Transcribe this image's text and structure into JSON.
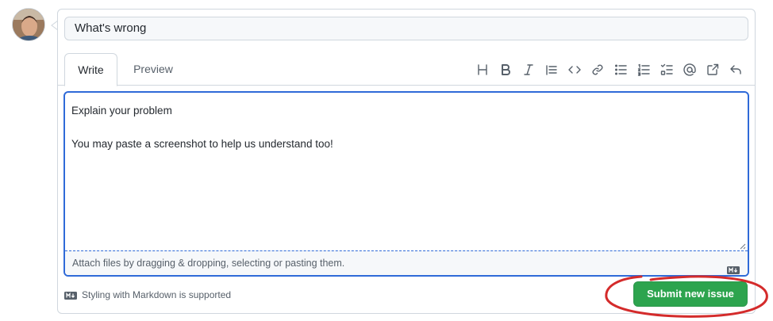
{
  "issue_form": {
    "title_value": "What's wrong",
    "tabs": [
      {
        "label": "Write",
        "active": true
      },
      {
        "label": "Preview",
        "active": false
      }
    ],
    "toolbar": [
      {
        "name": "heading-icon",
        "glyph": "H"
      },
      {
        "name": "bold-icon",
        "glyph": "B"
      },
      {
        "name": "italic-icon",
        "glyph": "I"
      },
      {
        "name": "quote-icon"
      },
      {
        "name": "code-icon"
      },
      {
        "name": "link-icon"
      },
      {
        "name": "unordered-list-icon"
      },
      {
        "name": "ordered-list-icon"
      },
      {
        "name": "task-list-icon"
      },
      {
        "name": "mention-icon"
      },
      {
        "name": "cross-reference-icon"
      },
      {
        "name": "reply-icon"
      }
    ],
    "body_text": "Explain your problem\n\nYou may paste a screenshot to help us understand too!",
    "attach_hint": "Attach files by dragging & dropping, selecting or pasting them.",
    "markdown_note": "Styling with Markdown is supported",
    "submit_label": "Submit new issue"
  },
  "colors": {
    "accent_blue": "#2f6ad8",
    "submit_green": "#2da44e",
    "annotation_red": "#d42b2b",
    "border": "#d0d7de"
  }
}
